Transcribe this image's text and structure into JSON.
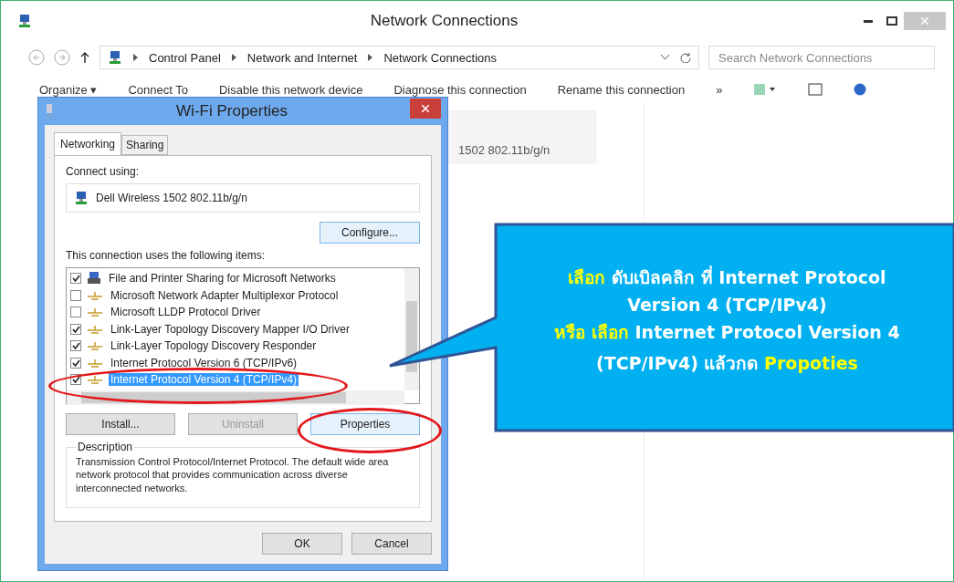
{
  "window": {
    "title": "Network Connections"
  },
  "address_bar": {
    "crumbs": [
      "Control Panel",
      "Network and Internet",
      "Network Connections"
    ]
  },
  "search": {
    "placeholder": "Search Network Connections"
  },
  "toolbar": {
    "items": [
      "Organize ▾",
      "Connect To",
      "Disable this network device",
      "Diagnose this connection",
      "Rename this connection",
      "»"
    ]
  },
  "connection_tile": {
    "subtitle": "1502 802.11b/g/n"
  },
  "dialog": {
    "title": "Wi-Fi Properties",
    "tabs": [
      {
        "label": "Networking",
        "selected": true
      },
      {
        "label": "Sharing",
        "selected": false
      }
    ],
    "connect_using_label": "Connect using:",
    "adapter": "Dell Wireless 1502 802.11b/g/n",
    "configure_button": "Configure...",
    "items_label": "This connection uses the following items:",
    "items": [
      {
        "label": "File and Printer Sharing for Microsoft Networks",
        "checked": true,
        "selected": false,
        "kind": "service"
      },
      {
        "label": "Microsoft Network Adapter Multiplexor Protocol",
        "checked": false,
        "selected": false,
        "kind": "protocol"
      },
      {
        "label": "Microsoft LLDP Protocol Driver",
        "checked": false,
        "selected": false,
        "kind": "protocol"
      },
      {
        "label": "Link-Layer Topology Discovery Mapper I/O Driver",
        "checked": true,
        "selected": false,
        "kind": "protocol"
      },
      {
        "label": "Link-Layer Topology Discovery Responder",
        "checked": true,
        "selected": false,
        "kind": "protocol"
      },
      {
        "label": "Internet Protocol Version 6 (TCP/IPv6)",
        "checked": true,
        "selected": false,
        "kind": "protocol"
      },
      {
        "label": "Internet Protocol Version 4 (TCP/IPv4)",
        "checked": true,
        "selected": true,
        "kind": "protocol"
      }
    ],
    "buttons": [
      {
        "label": "Install...",
        "disabled": false
      },
      {
        "label": "Uninstall",
        "disabled": true
      },
      {
        "label": "Properties",
        "disabled": false
      }
    ],
    "description_title": "Description",
    "description": "Transmission Control Protocol/Internet Protocol. The default wide area network protocol that provides communication across diverse interconnected networks.",
    "footer_buttons": [
      "OK",
      "Cancel"
    ]
  },
  "callout": {
    "lines": [
      [
        {
          "text": "เลือก",
          "highlight": true
        },
        {
          "text": " ดับเบิลคลิก ที่ Internet Protocol",
          "highlight": false
        }
      ],
      [
        {
          "text": "Version 4 (TCP/IPv4)",
          "highlight": false
        }
      ],
      [
        {
          "text": "หรือ เลือก",
          "highlight": true
        },
        {
          "text": " Internet Protocol Version 4",
          "highlight": false
        }
      ],
      [
        {
          "text": "(TCP/IPv4)  แล้วกด  ",
          "highlight": false
        },
        {
          "text": "Propoties",
          "highlight": true
        }
      ]
    ]
  }
}
